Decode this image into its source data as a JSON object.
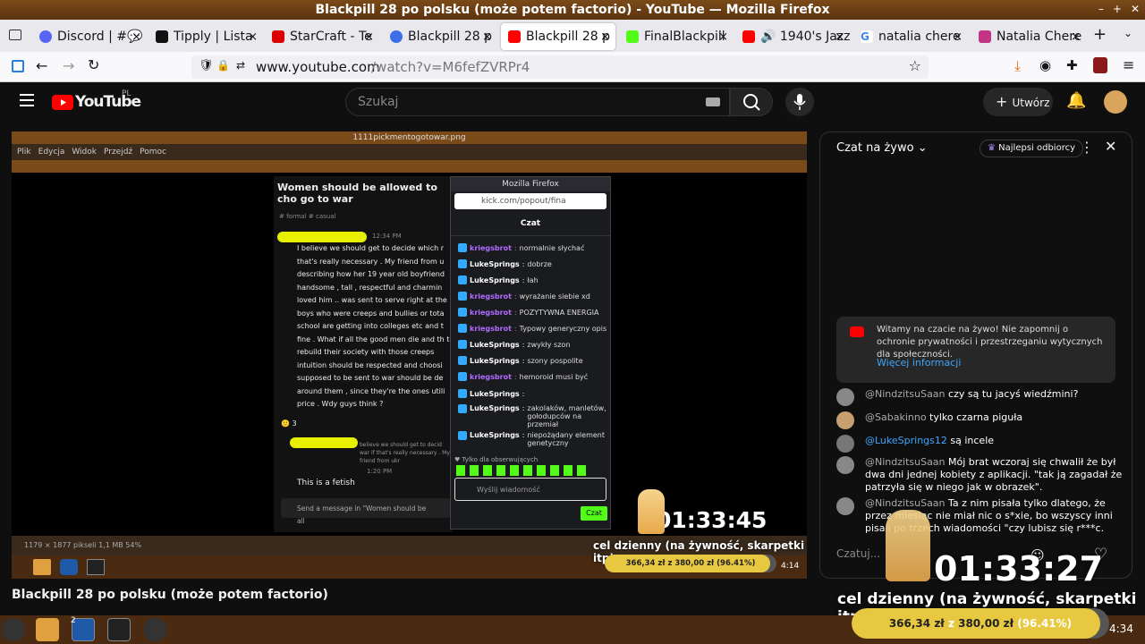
{
  "window": {
    "title": "Blackpill 28 po polsku (może potem factorio) - YouTube — Mozilla Firefox"
  },
  "tabs": [
    {
      "label": "Discord | #💬",
      "color": "#5865f2"
    },
    {
      "label": "Tipply | Lista",
      "color": "#111"
    },
    {
      "label": "StarCraft - Te",
      "color": "#d00"
    },
    {
      "label": "Blackpill 28 p",
      "color": "#3b6ee8"
    },
    {
      "label": "Blackpill 28 p",
      "color": "#f00"
    },
    {
      "label": "FinalBlackpill",
      "color": "#53fc18"
    },
    {
      "label": "🔊 1940's Jazz",
      "color": "#f00"
    },
    {
      "label": "natalia chere",
      "color": "#4285f4"
    },
    {
      "label": "Natalia Chere",
      "color": "#c13584"
    }
  ],
  "nav": {
    "url_host": "www.youtube.com",
    "url_path": "/watch?v=M6fefZVRPr4"
  },
  "yt": {
    "logo": "YouTube",
    "region": "PL",
    "search_placeholder": "Szukaj",
    "create_label": "Utwórz",
    "video_title": "Blackpill 28 po polsku (może potem factorio)"
  },
  "stream": {
    "viewer_title": "1111pickmentogotowar.png",
    "viewer_menu": [
      "Plik",
      "Edycja",
      "Widok",
      "Przejdź",
      "Pomoc"
    ],
    "viewer_status": "1179 × 1877 pikseli  1,1 MB   54%",
    "post_title": "Women should be allowed to cho go to war",
    "post_tags": [
      "formal",
      "casual"
    ],
    "post_time": "12:34 PM",
    "post_body": "I believe we should get to decide which r that's really necessary . My friend from u describing how her 19 year old boyfriend handsome , tall , respectful and charmin loved him .. was sent to serve right at the boys who were creeps and bullies or tota school are getting into colleges etc and t fine . What if all the good men die and th to rebuild their society with those creeps intuition should be respected and choosi supposed to be sent to war should be de around them , since they're the ones utili price . Wdy guys think ?",
    "reaction_count": "3",
    "reply_time": "1:20 PM",
    "reply_text": "This is a fetish",
    "reply_quote": "believe we should get to decid war if that's really necessary . My friend from ukr",
    "send_placeholder": "Send a message in \"Women should be all",
    "kick_window_title": "Mozilla Firefox",
    "kick_url": "kick.com/popout/fina",
    "kick_chat_title": "Czat",
    "kick_followers_only": "Tylko dla obserwujących",
    "kick_input_placeholder": "Wyślij wiadomość",
    "kick_send": "Czat",
    "kick_messages": [
      {
        "user": "kriegsbrot",
        "text": "normalnie słychać",
        "color": "#b06cff"
      },
      {
        "user": "LukeSprings",
        "text": "dobrze",
        "color": "#fff"
      },
      {
        "user": "LukeSprings",
        "text": "łah",
        "color": "#fff"
      },
      {
        "user": "kriegsbrot",
        "text": "wyrażanie siebie xd",
        "color": "#b06cff"
      },
      {
        "user": "kriegsbrot",
        "text": "POZYTYWNA ENERGIA",
        "color": "#b06cff"
      },
      {
        "user": "kriegsbrot",
        "text": "Typowy generyczny opis",
        "color": "#b06cff"
      },
      {
        "user": "LukeSprings",
        "text": "zwykły szon",
        "color": "#fff"
      },
      {
        "user": "LukeSprings",
        "text": "szony pospolite",
        "color": "#fff"
      },
      {
        "user": "kriegsbrot",
        "text": "hemoroid musi być",
        "color": "#b06cff"
      },
      {
        "user": "LukeSprings",
        "text": "",
        "color": "#fff"
      },
      {
        "user": "LukeSprings",
        "text": "zakolaków, manletów, gołodupców na przemiał",
        "color": "#fff"
      },
      {
        "user": "LukeSprings",
        "text": "niepożądany element genetyczny",
        "color": "#fff"
      }
    ],
    "timer_small": "01:33:45",
    "goal_small": "cel dzienny (na żywność, skarpetki itp)",
    "goal_small_value": "366,34 zł z 380,00 zł (96.41%)",
    "goal_small_progress": 0.9641,
    "clock_small": "4:14",
    "timer_big": "01:33:27",
    "goal_big": "cel dzienny (na żywność, skarpetki itp)",
    "goal_big_amount": "366,34 zł",
    "goal_big_of": "z",
    "goal_big_target": "380,00 zł",
    "goal_big_pct": "(96.41%)",
    "goal_big_progress": 0.9641,
    "clock_big": "4:34",
    "taskbar_badge": "2"
  },
  "chat": {
    "title": "Czat na żywo",
    "top_fans": "Najlepsi odbiorcy",
    "welcome": "Witamy na czacie na żywo! Nie zapomnij o ochronie prywatności i przestrzeganiu wytycznych dla społeczności.",
    "more_info": "Więcej informacji",
    "input_placeholder": "Czatuj...",
    "messages": [
      {
        "author": "@NindzitsuSaan",
        "text": "czy są tu jacyś wiedźmini?",
        "color": "#aaa"
      },
      {
        "author": "@Sabakinno",
        "text": "tylko czarna piguła",
        "color": "#aaa"
      },
      {
        "author": "@LukeSprings12",
        "text": "są incele",
        "color": "#3ea6ff"
      },
      {
        "author": "@NindzitsuSaan",
        "text": "Mój brat wczoraj się chwalił że był dwa dni jednej kobiety z aplikacji. \"tak ją zagadał że patrzyła się w niego jak w obrazek\".",
        "color": "#aaa"
      },
      {
        "author": "@NindzitsuSaan",
        "text": "Ta z nim pisała tylko dlatego, że przez miesiąc nie miał nic o s*xie, bo wszyscy inni pisali po trzech wiadomości \"czy lubisz się r***c.",
        "color": "#aaa"
      }
    ]
  }
}
